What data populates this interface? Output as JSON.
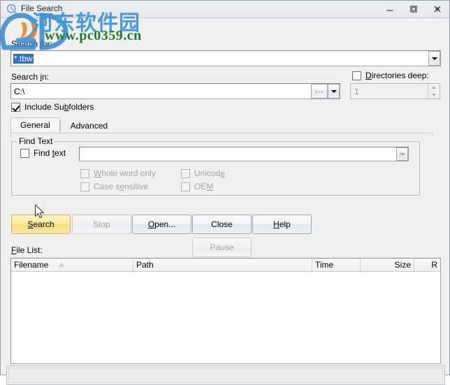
{
  "window": {
    "title": "File Search",
    "icon": "clock-search-icon",
    "controls": {
      "minimize": "minimize-icon",
      "maximize": "maximize-icon",
      "close": "close-icon"
    }
  },
  "search_for": {
    "label": "Search for:",
    "label_plain": "Search ",
    "label_accel": "f",
    "label_rest": "or:",
    "value": "*.tbw",
    "placeholder": "",
    "dropdown_icon": "chevron-down-icon"
  },
  "search_in": {
    "label_plain": "Search ",
    "label_accel": "i",
    "label_rest": "n:",
    "value": "C:\\",
    "browse_label": "...",
    "dropdown_icon": "chevron-down-icon"
  },
  "directories_deep": {
    "label_plain": "",
    "label_accel": "D",
    "label_rest": "irectories deep:",
    "checked": false,
    "value": "1",
    "enabled": false
  },
  "include_subfolders": {
    "label_plain": "Include Su",
    "label_accel": "b",
    "label_rest": "folders",
    "checked": true
  },
  "tabs": [
    {
      "label": "General",
      "active": true
    },
    {
      "label": "Advanced",
      "active": false
    }
  ],
  "find_text_group": {
    "title": "Find Text",
    "find_text": {
      "label_plain": "Find ",
      "label_accel": "t",
      "label_rest": "ext",
      "checked": false,
      "value": "",
      "placeholder": "",
      "dropdown_icon": "chevron-down-icon",
      "enabled": true
    },
    "options": [
      {
        "label_plain": "",
        "label_accel": "W",
        "label_rest": "hole word only",
        "checked": false,
        "enabled": false
      },
      {
        "label_plain": "Case s",
        "label_accel": "e",
        "label_rest": "nsitive",
        "checked": false,
        "enabled": false
      },
      {
        "label_plain": "Unicod",
        "label_accel": "e",
        "label_rest": "",
        "checked": false,
        "enabled": false
      },
      {
        "label_plain": "OE",
        "label_accel": "M",
        "label_rest": "",
        "checked": false,
        "enabled": false
      }
    ]
  },
  "buttons": [
    {
      "name": "search",
      "label_plain": "",
      "label_accel": "S",
      "label_rest": "earch",
      "state": "hot"
    },
    {
      "name": "stop",
      "label_plain": "Stop",
      "label_accel": "",
      "label_rest": "",
      "state": "disabled"
    },
    {
      "name": "open",
      "label_plain": "",
      "label_accel": "O",
      "label_rest": "pen...",
      "state": "normal"
    },
    {
      "name": "close",
      "label_plain": "Close",
      "label_accel": "",
      "label_rest": "",
      "state": "normal"
    },
    {
      "name": "help",
      "label_plain": "",
      "label_accel": "H",
      "label_rest": "elp",
      "state": "normal"
    },
    {
      "name": "pause",
      "label_plain": "Pause",
      "label_accel": "",
      "label_rest": "",
      "state": "disabled"
    }
  ],
  "file_list": {
    "label_plain": "",
    "label_accel": "F",
    "label_rest": "ile List:",
    "columns": [
      {
        "title": "Filename",
        "align": "left",
        "sorted": "asc"
      },
      {
        "title": "Path",
        "align": "left",
        "sorted": ""
      },
      {
        "title": "Time",
        "align": "left",
        "sorted": ""
      },
      {
        "title": "Size",
        "align": "right",
        "sorted": ""
      },
      {
        "title": "R",
        "align": "right",
        "sorted": ""
      }
    ],
    "rows": []
  },
  "watermark": {
    "chinese": "河东软件园",
    "url": "www.pc0359.cn",
    "logo": "2d-logo",
    "colors": {
      "chinese": "#3d94d9",
      "url": "#1f7a2e",
      "logo_blue": "#2f87cf",
      "logo_orange": "#e8811f"
    }
  },
  "cursor": {
    "type": "arrow-cursor"
  },
  "colors": {
    "window_bg": "#f0f0f0",
    "titlebar": "#e8eaed",
    "hot_button": "#f8dd7c",
    "field_bg": "#ffffff",
    "disabled_text": "#a4a4a4"
  }
}
